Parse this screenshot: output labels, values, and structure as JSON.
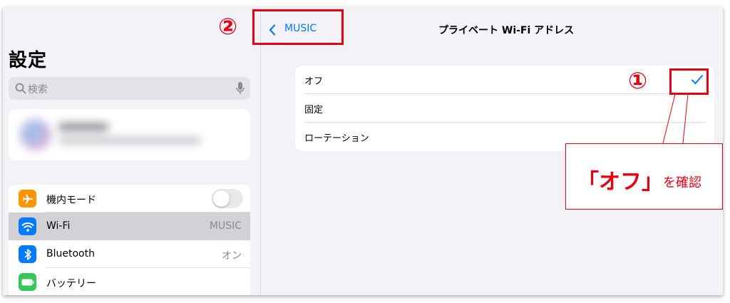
{
  "sidebar": {
    "title": "設定",
    "search": {
      "placeholder": "検索",
      "icon": "magnifier-icon",
      "mic_icon": "microphone-icon"
    },
    "items": [
      {
        "label": "機内モード",
        "icon": "airplane-icon",
        "icon_color": "#ff9500",
        "control": "toggle",
        "toggle_on": false
      },
      {
        "label": "Wi-Fi",
        "icon": "wifi-icon",
        "icon_color": "#007aff",
        "value": "MUSIC",
        "selected": true
      },
      {
        "label": "Bluetooth",
        "icon": "bluetooth-icon",
        "icon_color": "#007aff",
        "value": "オン"
      },
      {
        "label": "バッテリー",
        "icon": "battery-icon",
        "icon_color": "#34c759"
      }
    ]
  },
  "navbar": {
    "back_label": "MUSIC",
    "title": "プライベート Wi-Fi アドレス"
  },
  "options": [
    {
      "label": "オフ",
      "checked": true
    },
    {
      "label": "固定",
      "checked": false
    },
    {
      "label": "ローテーション",
      "checked": false
    }
  ],
  "annotations": {
    "step1": "①",
    "step2": "②",
    "callout_main": "「オフ」",
    "callout_sub": "を確認",
    "color": "#e60012"
  },
  "colors": {
    "accent": "#007aff",
    "background": "#f2f2f7",
    "selected_row": "#d1d1d6"
  }
}
